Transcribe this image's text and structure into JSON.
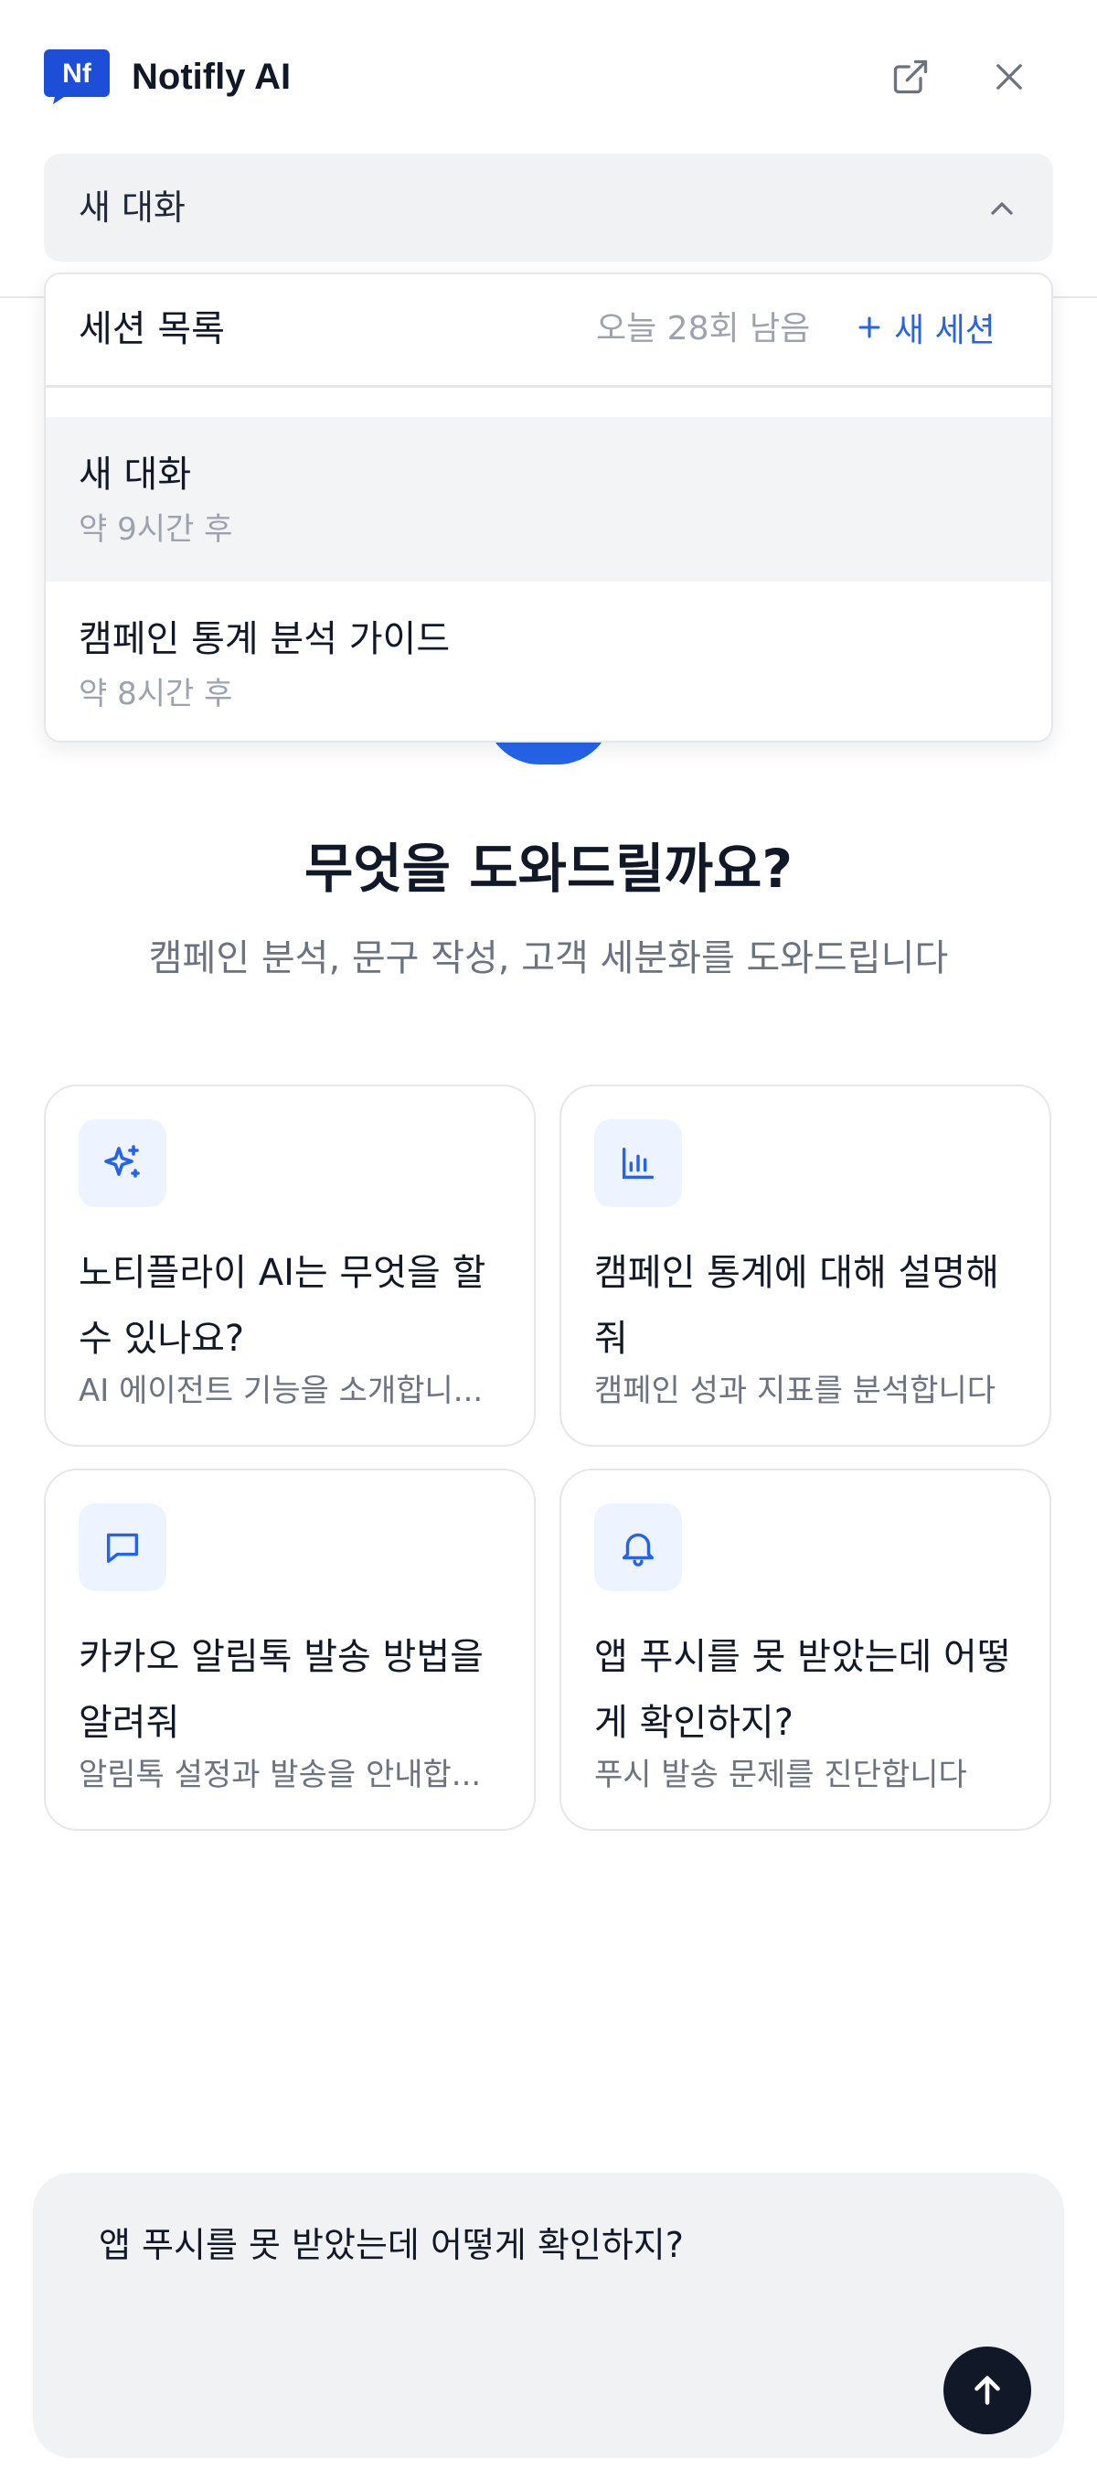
{
  "header": {
    "logo_text": "Nf",
    "title": "Notifly AI"
  },
  "selector": {
    "current_session": "새 대화"
  },
  "dropdown": {
    "title": "세션 목록",
    "remaining": "오늘 28회 남음",
    "new_session_label": "새 세션",
    "sessions": [
      {
        "title": "새 대화",
        "time": "약 9시간 후"
      },
      {
        "title": "캠페인 통계 분석 가이드",
        "time": "약 8시간 후"
      }
    ]
  },
  "hero": {
    "title": "무엇을 도와드릴까요?",
    "subtitle": "캠페인 분석, 문구 작성, 고객 세분화를 도와드립니다"
  },
  "cards": [
    {
      "icon": "sparkles-icon",
      "title": "노티플라이 AI는 무엇을 할 수 있나요?",
      "desc": "AI 에이전트 기능을 소개합니..."
    },
    {
      "icon": "bar-chart-icon",
      "title": "캠페인 통계에 대해 설명해줘",
      "desc": "캠페인 성과 지표를 분석합니다"
    },
    {
      "icon": "chat-bubble-icon",
      "title": "카카오 알림톡 발송 방법을 알려줘",
      "desc": "알림톡 설정과 발송을 안내합..."
    },
    {
      "icon": "bell-icon",
      "title": "앱 푸시를 못 받았는데 어떻게 확인하지?",
      "desc": "푸시 발송 문제를 진단합니다"
    }
  ],
  "composer": {
    "value": "앱 푸시를 못 받았는데 어떻게 확인하지?"
  },
  "colors": {
    "accent": "#2563eb",
    "text": "#111827",
    "muted": "#6b7280",
    "surface": "#f1f2f4",
    "icon_bg": "#eef4ff"
  }
}
